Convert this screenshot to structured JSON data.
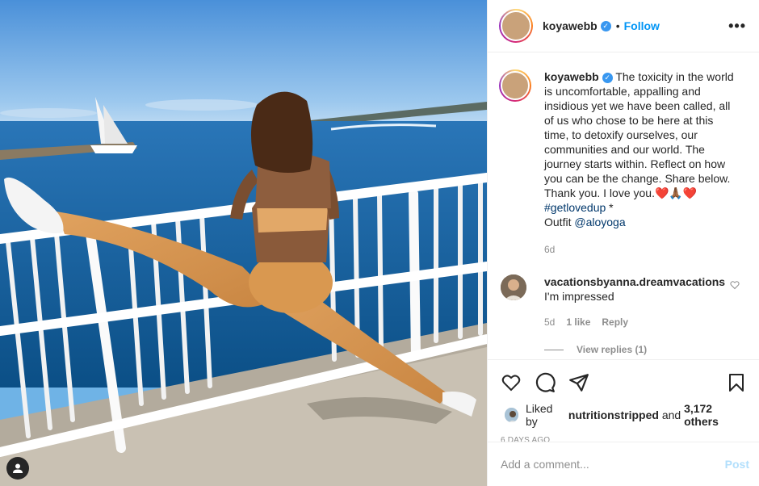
{
  "post": {
    "image": "woman-stretching-on-pier-railing",
    "author": "koyawebb",
    "verified": true,
    "follow_separator": "•",
    "follow_label": "Follow",
    "more_label": "•••",
    "caption_text": "The toxicity in the world is uncomfortable, appalling and insidious yet we have been called, all of us who chose to be here at this time, to detoxify ourselves, our communities and our world. The journey starts within. Reflect on how you can be the change. Share below. Thank you. I love you.",
    "caption_emojis": "❤️🙏🏾❤️",
    "hashtag": "#getlovedup",
    "hashtag_suffix": " *",
    "outfit_label": "Outfit",
    "outfit_tag": "@aloyoga",
    "caption_age": "6d"
  },
  "comments": [
    {
      "user": "vacationsbyanna.dreamvacations",
      "text": "I'm impressed",
      "age": "5d",
      "likes": "1 like",
      "reply_label": "Reply",
      "view_replies": "View replies (1)"
    }
  ],
  "footer": {
    "liked_by_prefix": "Liked by",
    "liked_by_user": "nutritionstripped",
    "and_label": "and",
    "others": "3,172 others",
    "date": "6 DAYS AGO",
    "comment_placeholder": "Add a comment...",
    "post_label": "Post"
  },
  "colors": {
    "link": "#00376b",
    "follow": "#0095f6",
    "post_disabled": "#b2dffc",
    "heart": "#ed4956"
  }
}
